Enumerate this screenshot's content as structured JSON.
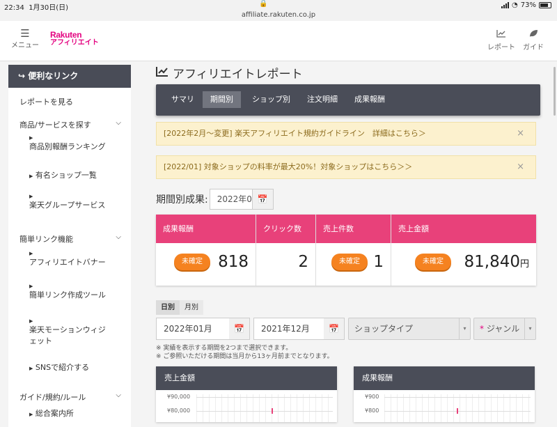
{
  "status": {
    "time": "22:34",
    "date": "1月30日(日)",
    "url": "affiliate.rakuten.co.jp",
    "battery": "73%"
  },
  "header": {
    "menu_label": "メニュー",
    "logo_line1": "Rakuten",
    "logo_line2": "アフィリエイト",
    "report_label": "レポート",
    "guide_label": "ガイド"
  },
  "sidebar": {
    "heading": "便利なリンク",
    "items": [
      {
        "label": "レポートを見る"
      },
      {
        "label": "商品/サービスを探す"
      },
      {
        "label": "商品別報酬ランキング"
      },
      {
        "label": "有名ショップ一覧"
      },
      {
        "label": "楽天グループサービス"
      },
      {
        "label": "簡単リンク機能"
      },
      {
        "label": "アフィリエイトバナー"
      },
      {
        "label": "簡単リンク作成ツール"
      },
      {
        "label": "楽天モーションウィジ"
      },
      {
        "label": "ェット"
      },
      {
        "label": "SNSで紹介する"
      },
      {
        "label": "ガイド/規約/ルール"
      },
      {
        "label": "総合案内所"
      }
    ]
  },
  "main": {
    "title": "アフィリエイトレポート",
    "tabs": [
      {
        "label": "サマリ"
      },
      {
        "label": "期間別"
      },
      {
        "label": "ショップ別"
      },
      {
        "label": "注文明細"
      },
      {
        "label": "成果報酬"
      }
    ],
    "notices": [
      {
        "text": "[2022年2月～変更] 楽天アフィリエイト規約ガイドライン　詳細はこちら＞",
        "close": "×"
      },
      {
        "text": "[2022/01] 対象ショップの料率が最大20%！対象ショップはこちら＞＞",
        "close": "×"
      }
    ],
    "period_label": "期間別成果:",
    "period_value": "2022年0",
    "stats": [
      {
        "head": "成果報酬",
        "pill": "未確定",
        "value": "818",
        "unit": ""
      },
      {
        "head": "クリック数",
        "pill": "",
        "value": "2",
        "unit": ""
      },
      {
        "head": "売上件数",
        "pill": "未確定",
        "value": "1",
        "unit": ""
      },
      {
        "head": "売上金額",
        "pill": "未確定",
        "value": "81,840",
        "unit": "円"
      }
    ],
    "toggle": {
      "daily": "日別",
      "monthly": "月別"
    },
    "filters": {
      "from": "2022年01月",
      "to": "2021年12月",
      "shop_type": "ショップタイプ",
      "genre_req": "*",
      "genre": "ジャンル"
    },
    "notes": [
      "※ 実績を表示する期間を2つまで選択できます。",
      "※ ご参照いただける期間は当月から13ヶ月前までとなります。"
    ],
    "panels": [
      {
        "title": "売上金額",
        "ticks": [
          "¥90,000",
          "¥80,000"
        ]
      },
      {
        "title": "成果報酬",
        "ticks": [
          "¥900",
          "¥800"
        ]
      }
    ]
  },
  "colors": {
    "accent_pink": "#e8417a",
    "dark_bar": "#4a4d58",
    "pill_orange": "#f58220",
    "notice_bg": "#fcf1ce",
    "brand": "#e3007f"
  }
}
